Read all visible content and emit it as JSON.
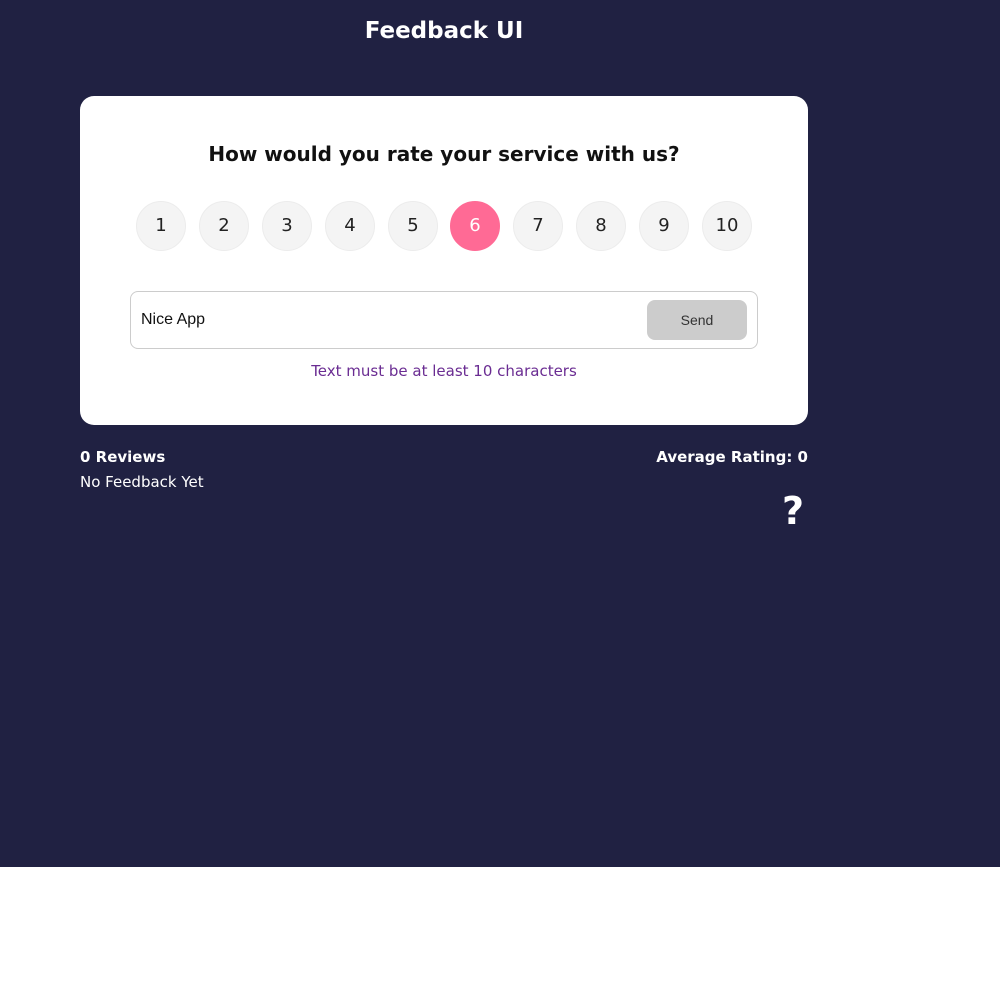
{
  "header": {
    "title": "Feedback UI"
  },
  "rating_card": {
    "question": "How would you rate your service with us?",
    "options": [
      "1",
      "2",
      "3",
      "4",
      "5",
      "6",
      "7",
      "8",
      "9",
      "10"
    ],
    "selected": "6"
  },
  "review_form": {
    "input_value": "Nice App",
    "send_label": "Send",
    "validation_message": "Text must be at least 10 characters"
  },
  "stats": {
    "review_count_label": "0 Reviews",
    "average_rating_label": "Average Rating: 0"
  },
  "feedback_list": {
    "empty_message": "No Feedback Yet"
  },
  "icons": {
    "help": "question-mark-icon"
  },
  "colors": {
    "page_background": "#202142",
    "card_background": "#ffffff",
    "selected_rating": "#ff6a95",
    "validation_text": "#6a2c92",
    "send_button": "#cccccc"
  }
}
